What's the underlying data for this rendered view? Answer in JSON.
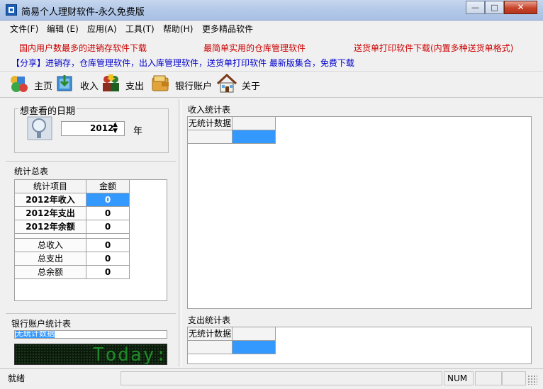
{
  "window": {
    "title": "简易个人理财软件-永久免费版",
    "minimize": "—",
    "maximize": "□",
    "close": "✕"
  },
  "menu": [
    "文件(F)",
    "编辑 (E)",
    "应用(A)",
    "工具(T)",
    "帮助(H)",
    "更多精品软件"
  ],
  "links": {
    "link1": "国内用户数最多的进销存软件下载",
    "link2": "最简单实用的仓库管理软件",
    "link3": "送货单打印软件下载(内置多种送货单格式)",
    "share": "【分享】进销存，仓库管理软件，出入库管理软件，送货单打印软件 最新版集合，免费下载"
  },
  "toolbar": [
    {
      "label": "主页",
      "icon": "shapes-icon"
    },
    {
      "label": "收入",
      "icon": "income-icon"
    },
    {
      "label": "支出",
      "icon": "expense-icon"
    },
    {
      "label": "银行账户",
      "icon": "wallet-icon"
    },
    {
      "label": "关于",
      "icon": "house-icon"
    }
  ],
  "date_group": {
    "title": "想查看的日期",
    "year_value": "2012",
    "year_unit": "年"
  },
  "summary": {
    "title": "统计总表",
    "col1": "统计项目",
    "col2": "金额",
    "rows": [
      {
        "item": "2012年收入",
        "amount": "0"
      },
      {
        "item": "2012年支出",
        "amount": "0"
      },
      {
        "item": "2012年余额",
        "amount": "0"
      },
      {
        "item": "总收入",
        "amount": "0"
      },
      {
        "item": "总支出",
        "amount": "0"
      },
      {
        "item": "总余额",
        "amount": "0"
      }
    ]
  },
  "bank": {
    "title": "银行账户统计表",
    "row_text": "无统计数据",
    "led_text": "Today:"
  },
  "income": {
    "title": "收入统计表",
    "header": "无统计数据"
  },
  "expense": {
    "title": "支出统计表",
    "header": "无统计数据"
  },
  "statusbar": {
    "ready": "就绪",
    "num": "NUM"
  }
}
